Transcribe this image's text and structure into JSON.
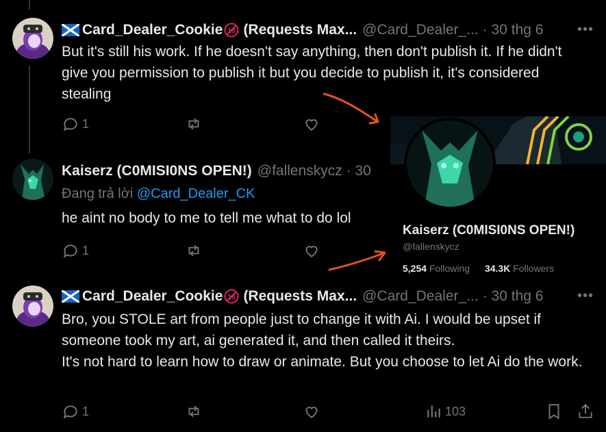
{
  "tweets": [
    {
      "author": "Card_Dealer_Cookie",
      "author_suffix": "(Requests Max...",
      "handle": "@Card_Dealer_...",
      "time": "· 30 thg 6",
      "more": "•••",
      "text": "But it's still his work. If he doesn't say anything, then don't publish it. If he didn't give you permission to publish it but you decide to publish it, it's considered stealing",
      "reply_count": "1"
    },
    {
      "author": "Kaiserz (C0MISI0NS OPEN!)",
      "handle": "@fallenskycz · 30",
      "reply_label": "Đang trả lời",
      "reply_handle": "@Card_Dealer_CK",
      "text": "he aint no body to me to tell me what to do lol",
      "reply_count": "1"
    },
    {
      "author": "Card_Dealer_Cookie",
      "author_suffix": "(Requests Max...",
      "handle": "@Card_Dealer_...",
      "time": "· 30 thg 6",
      "more": "•••",
      "text_lines": [
        "Bro, you STOLE art from people just to change it with Ai. I would be upset if someone took my art, ai generated it, and then called it theirs.",
        "It's not hard to learn how to draw or animate. But you choose to let Ai do the work."
      ],
      "reply_count": "1",
      "views": "103"
    }
  ],
  "hover_card": {
    "name": "Kaiserz (C0MISI0NS OPEN!)",
    "handle": "@fallenskycz",
    "following_count": "5,254",
    "following_label": "Following",
    "followers_count": "34.3K",
    "followers_label": "Followers"
  },
  "colors": {
    "background": "#000000",
    "text": "#e7e9ea",
    "muted": "#71767b",
    "link": "#1d9bf0",
    "annotation_arrow": "#e0531f"
  },
  "icons": [
    "reply-icon",
    "retweet-icon",
    "like-icon",
    "views-icon",
    "bookmark-icon",
    "share-icon",
    "scotland-flag-icon",
    "eighteen-plus-icon"
  ]
}
